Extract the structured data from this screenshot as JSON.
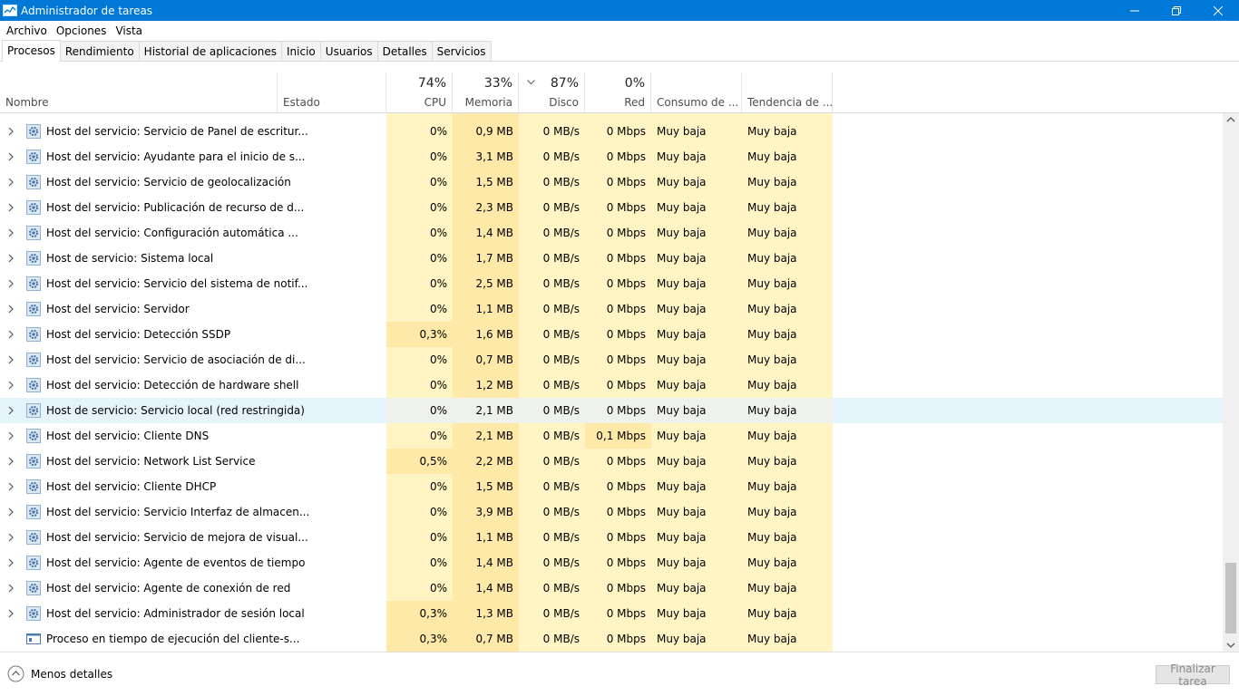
{
  "window": {
    "title": "Administrador de tareas"
  },
  "menu": [
    "Archivo",
    "Opciones",
    "Vista"
  ],
  "tabs": [
    "Procesos",
    "Rendimiento",
    "Historial de aplicaciones",
    "Inicio",
    "Usuarios",
    "Detalles",
    "Servicios"
  ],
  "active_tab": "Procesos",
  "columns": {
    "name": "Nombre",
    "status": "Estado",
    "cpu": {
      "label": "CPU",
      "pct": "74%"
    },
    "memory": {
      "label": "Memoria",
      "pct": "33%"
    },
    "disk": {
      "label": "Disco",
      "pct": "87%"
    },
    "network": {
      "label": "Red",
      "pct": "0%"
    },
    "power": "Consumo de ...",
    "power_trend": "Tendencia de ..."
  },
  "heat_colors": {
    "low": "#fff4c4",
    "mid": "#ffe9a8",
    "selected_row": "#e5f3fb"
  },
  "processes": [
    {
      "name": "Host del servicio: Servicio de Panel de escritur...",
      "cpu": "0%",
      "mem": "0,9 MB",
      "disk": "0 MB/s",
      "net": "0 Mbps",
      "power": "Muy baja",
      "trend": "Muy baja",
      "icon": "gear-icon",
      "expandable": true
    },
    {
      "name": "Host del servicio: Ayudante para el inicio de s...",
      "cpu": "0%",
      "mem": "3,1 MB",
      "disk": "0 MB/s",
      "net": "0 Mbps",
      "power": "Muy baja",
      "trend": "Muy baja",
      "icon": "gear-icon",
      "expandable": true
    },
    {
      "name": "Host del servicio: Servicio de geolocalización",
      "cpu": "0%",
      "mem": "1,5 MB",
      "disk": "0 MB/s",
      "net": "0 Mbps",
      "power": "Muy baja",
      "trend": "Muy baja",
      "icon": "gear-icon",
      "expandable": true
    },
    {
      "name": "Host del servicio: Publicación de recurso de d...",
      "cpu": "0%",
      "mem": "2,3 MB",
      "disk": "0 MB/s",
      "net": "0 Mbps",
      "power": "Muy baja",
      "trend": "Muy baja",
      "icon": "gear-icon",
      "expandable": true
    },
    {
      "name": "Host del servicio: Configuración automática ...",
      "cpu": "0%",
      "mem": "1,4 MB",
      "disk": "0 MB/s",
      "net": "0 Mbps",
      "power": "Muy baja",
      "trend": "Muy baja",
      "icon": "gear-icon",
      "expandable": true
    },
    {
      "name": "Host de servicio: Sistema local",
      "cpu": "0%",
      "mem": "1,7 MB",
      "disk": "0 MB/s",
      "net": "0 Mbps",
      "power": "Muy baja",
      "trend": "Muy baja",
      "icon": "gear-icon",
      "expandable": true
    },
    {
      "name": "Host del servicio: Servicio del sistema de notif...",
      "cpu": "0%",
      "mem": "2,5 MB",
      "disk": "0 MB/s",
      "net": "0 Mbps",
      "power": "Muy baja",
      "trend": "Muy baja",
      "icon": "gear-icon",
      "expandable": true
    },
    {
      "name": "Host del servicio: Servidor",
      "cpu": "0%",
      "mem": "1,1 MB",
      "disk": "0 MB/s",
      "net": "0 Mbps",
      "power": "Muy baja",
      "trend": "Muy baja",
      "icon": "gear-icon",
      "expandable": true
    },
    {
      "name": "Host del servicio: Detección SSDP",
      "cpu": "0,3%",
      "mem": "1,6 MB",
      "disk": "0 MB/s",
      "net": "0 Mbps",
      "power": "Muy baja",
      "trend": "Muy baja",
      "icon": "gear-icon",
      "expandable": true
    },
    {
      "name": "Host del servicio: Servicio de asociación de di...",
      "cpu": "0%",
      "mem": "0,7 MB",
      "disk": "0 MB/s",
      "net": "0 Mbps",
      "power": "Muy baja",
      "trend": "Muy baja",
      "icon": "gear-icon",
      "expandable": true
    },
    {
      "name": "Host del servicio: Detección de hardware shell",
      "cpu": "0%",
      "mem": "1,2 MB",
      "disk": "0 MB/s",
      "net": "0 Mbps",
      "power": "Muy baja",
      "trend": "Muy baja",
      "icon": "gear-icon",
      "expandable": true
    },
    {
      "name": "Host de servicio: Servicio local (red restringida)",
      "cpu": "0%",
      "mem": "2,1 MB",
      "disk": "0 MB/s",
      "net": "0 Mbps",
      "power": "Muy baja",
      "trend": "Muy baja",
      "icon": "gear-icon",
      "expandable": true,
      "selected": true
    },
    {
      "name": "Host del servicio: Cliente DNS",
      "cpu": "0%",
      "mem": "2,1 MB",
      "disk": "0 MB/s",
      "net": "0,1 Mbps",
      "power": "Muy baja",
      "trend": "Muy baja",
      "icon": "gear-icon",
      "expandable": true
    },
    {
      "name": "Host del servicio: Network List Service",
      "cpu": "0,5%",
      "mem": "2,2 MB",
      "disk": "0 MB/s",
      "net": "0 Mbps",
      "power": "Muy baja",
      "trend": "Muy baja",
      "icon": "gear-icon",
      "expandable": true
    },
    {
      "name": "Host del servicio: Cliente DHCP",
      "cpu": "0%",
      "mem": "1,5 MB",
      "disk": "0 MB/s",
      "net": "0 Mbps",
      "power": "Muy baja",
      "trend": "Muy baja",
      "icon": "gear-icon",
      "expandable": true
    },
    {
      "name": "Host del servicio: Servicio Interfaz de almacen...",
      "cpu": "0%",
      "mem": "3,9 MB",
      "disk": "0 MB/s",
      "net": "0 Mbps",
      "power": "Muy baja",
      "trend": "Muy baja",
      "icon": "gear-icon",
      "expandable": true
    },
    {
      "name": "Host del servicio: Servicio de mejora de visual...",
      "cpu": "0%",
      "mem": "1,1 MB",
      "disk": "0 MB/s",
      "net": "0 Mbps",
      "power": "Muy baja",
      "trend": "Muy baja",
      "icon": "gear-icon",
      "expandable": true
    },
    {
      "name": "Host del servicio: Agente de eventos de tiempo",
      "cpu": "0%",
      "mem": "1,4 MB",
      "disk": "0 MB/s",
      "net": "0 Mbps",
      "power": "Muy baja",
      "trend": "Muy baja",
      "icon": "gear-icon",
      "expandable": true
    },
    {
      "name": "Host del servicio: Agente de conexión de red",
      "cpu": "0%",
      "mem": "1,4 MB",
      "disk": "0 MB/s",
      "net": "0 Mbps",
      "power": "Muy baja",
      "trend": "Muy baja",
      "icon": "gear-icon",
      "expandable": true
    },
    {
      "name": "Host del servicio: Administrador de sesión local",
      "cpu": "0,3%",
      "mem": "1,3 MB",
      "disk": "0 MB/s",
      "net": "0 Mbps",
      "power": "Muy baja",
      "trend": "Muy baja",
      "icon": "gear-icon",
      "expandable": true
    },
    {
      "name": "Proceso en tiempo de ejecución del cliente-s...",
      "cpu": "0,3%",
      "mem": "0,7 MB",
      "disk": "0 MB/s",
      "net": "0 Mbps",
      "power": "Muy baja",
      "trend": "Muy baja",
      "icon": "window-icon",
      "expandable": false
    }
  ],
  "footer": {
    "less_details": "Menos detalles",
    "end_task": "Finalizar tarea"
  }
}
